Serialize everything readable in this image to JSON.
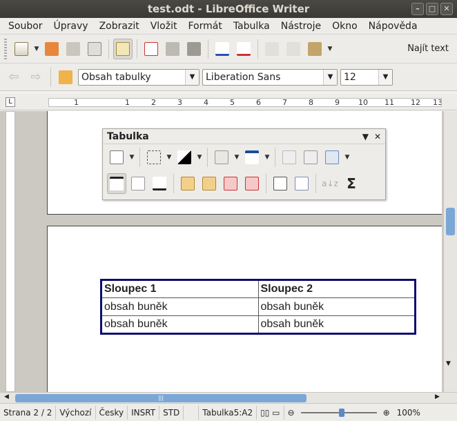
{
  "window": {
    "title": "test.odt - LibreOffice Writer"
  },
  "menubar": {
    "items": [
      {
        "label": "Soubor"
      },
      {
        "label": "Úpravy"
      },
      {
        "label": "Zobrazit"
      },
      {
        "label": "Vložit"
      },
      {
        "label": "Formát"
      },
      {
        "label": "Tabulka"
      },
      {
        "label": "Nástroje"
      },
      {
        "label": "Okno"
      },
      {
        "label": "Nápověda"
      }
    ]
  },
  "standard_toolbar": {
    "find_label": "Najít text"
  },
  "formatting_toolbar": {
    "style": "Obsah tabulky",
    "font": "Liberation Sans",
    "size": "12"
  },
  "ruler": {
    "numbers": [
      "1",
      "1",
      "2",
      "3",
      "4",
      "5",
      "6",
      "7",
      "8",
      "9",
      "10",
      "11",
      "12",
      "13"
    ]
  },
  "table_toolbar": {
    "title": "Tabulka"
  },
  "document": {
    "table": {
      "headers": [
        "Sloupec 1",
        "Sloupec 2"
      ],
      "rows": [
        [
          "obsah buněk",
          "obsah buněk"
        ],
        [
          "obsah buněk",
          "obsah buněk"
        ]
      ]
    }
  },
  "statusbar": {
    "page": "Strana 2 / 2",
    "style": "Výchozí",
    "language": "Česky",
    "insert_mode": "INSRT",
    "selection_mode": "STD",
    "table_cell": "Tabulka5:A2",
    "zoom": "100%",
    "zoom_level": 1.0
  },
  "colors": {
    "table_border": "#0c0c6e",
    "scroll_thumb": "#7aa7d6"
  }
}
